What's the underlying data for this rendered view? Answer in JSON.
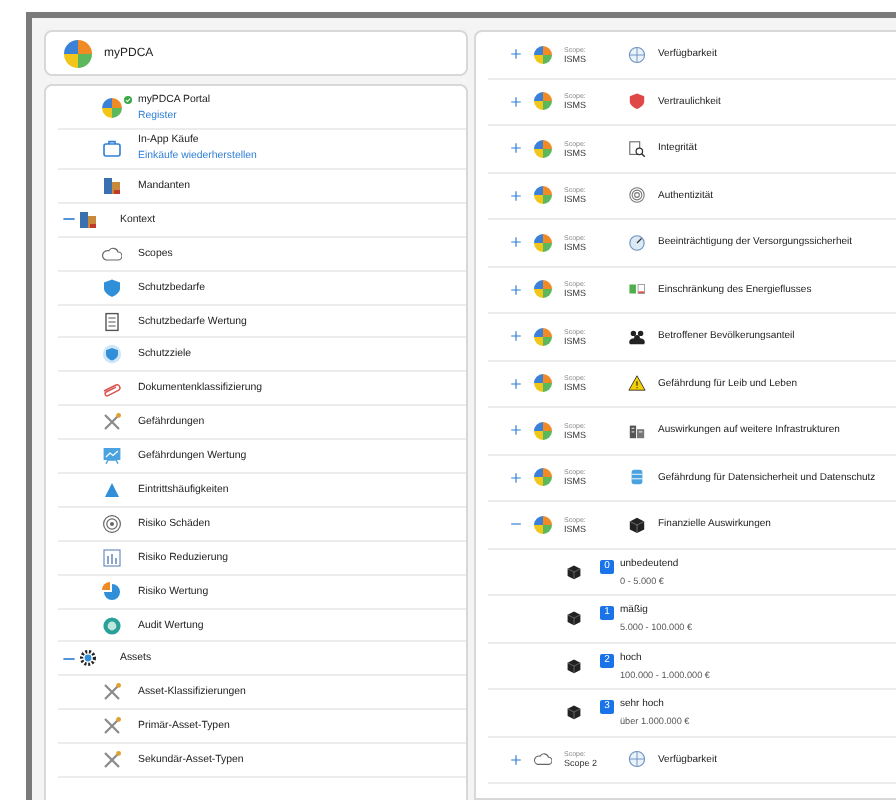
{
  "header": {
    "title": "myPDCA"
  },
  "sidebar": {
    "items": [
      {
        "label": "myPDCA Portal",
        "link": "Register",
        "verified": true
      },
      {
        "label": "In-App Käufe",
        "link": "Einkäufe wiederherstellen"
      },
      {
        "label": "Mandanten"
      },
      {
        "label": "Kontext",
        "expanded": true,
        "children": [
          {
            "label": "Scopes"
          },
          {
            "label": "Schutzbedarfe"
          },
          {
            "label": "Schutzbedarfe Wertung"
          },
          {
            "label": "Schutzziele"
          },
          {
            "label": "Dokumentenklassifizierung"
          },
          {
            "label": "Gefährdungen"
          },
          {
            "label": "Gefährdungen Wertung"
          },
          {
            "label": "Eintrittshäufigkeiten"
          },
          {
            "label": "Risiko Schäden"
          },
          {
            "label": "Risiko Reduzierung"
          },
          {
            "label": "Risiko Wertung"
          },
          {
            "label": "Audit Wertung"
          }
        ]
      },
      {
        "label": "Assets",
        "expanded": true,
        "children": [
          {
            "label": "Asset-Klassifizierungen"
          },
          {
            "label": "Primär-Asset-Typen"
          },
          {
            "label": "Sekundär-Asset-Typen"
          }
        ]
      }
    ]
  },
  "list": {
    "rows": [
      {
        "kind": "isms",
        "expanded": false,
        "scope_label": "Scope:",
        "scope": "ISMS",
        "label": "Verfügbarkeit"
      },
      {
        "kind": "isms",
        "expanded": false,
        "scope_label": "Scope:",
        "scope": "ISMS",
        "label": "Vertraulichkeit"
      },
      {
        "kind": "isms",
        "expanded": false,
        "scope_label": "Scope:",
        "scope": "ISMS",
        "label": "Integrität"
      },
      {
        "kind": "isms",
        "expanded": false,
        "scope_label": "Scope:",
        "scope": "ISMS",
        "label": "Authentizität"
      },
      {
        "kind": "isms",
        "expanded": false,
        "scope_label": "Scope:",
        "scope": "ISMS",
        "label": "Beeinträchtigung der Versorgungssicherheit"
      },
      {
        "kind": "isms",
        "expanded": false,
        "scope_label": "Scope:",
        "scope": "ISMS",
        "label": "Einschränkung des Energieflusses"
      },
      {
        "kind": "isms",
        "expanded": false,
        "scope_label": "Scope:",
        "scope": "ISMS",
        "label": "Betroffener Bevölkerungsanteil"
      },
      {
        "kind": "isms",
        "expanded": false,
        "scope_label": "Scope:",
        "scope": "ISMS",
        "label": "Gefährdung für Leib und Leben"
      },
      {
        "kind": "isms",
        "expanded": false,
        "scope_label": "Scope:",
        "scope": "ISMS",
        "label": "Auswirkungen auf weitere Infrastrukturen"
      },
      {
        "kind": "isms",
        "expanded": false,
        "scope_label": "Scope:",
        "scope": "ISMS",
        "label": "Gefährdung für Datensicherheit und Datenschutz"
      },
      {
        "kind": "isms",
        "expanded": true,
        "scope_label": "Scope:",
        "scope": "ISMS",
        "label": "Finanzielle Auswirkungen",
        "children": [
          {
            "rank": "0",
            "label": "unbedeutend",
            "range": "0 - 5.000 €"
          },
          {
            "rank": "1",
            "label": "mäßig",
            "range": "5.000 - 100.000 €"
          },
          {
            "rank": "2",
            "label": "hoch",
            "range": "100.000 - 1.000.000 €"
          },
          {
            "rank": "3",
            "label": "sehr hoch",
            "range": "über 1.000.000 €"
          }
        ]
      },
      {
        "kind": "scope",
        "expanded": false,
        "scope_label": "Scope:",
        "scope": "Scope 2",
        "label": "Verfügbarkeit"
      }
    ]
  }
}
